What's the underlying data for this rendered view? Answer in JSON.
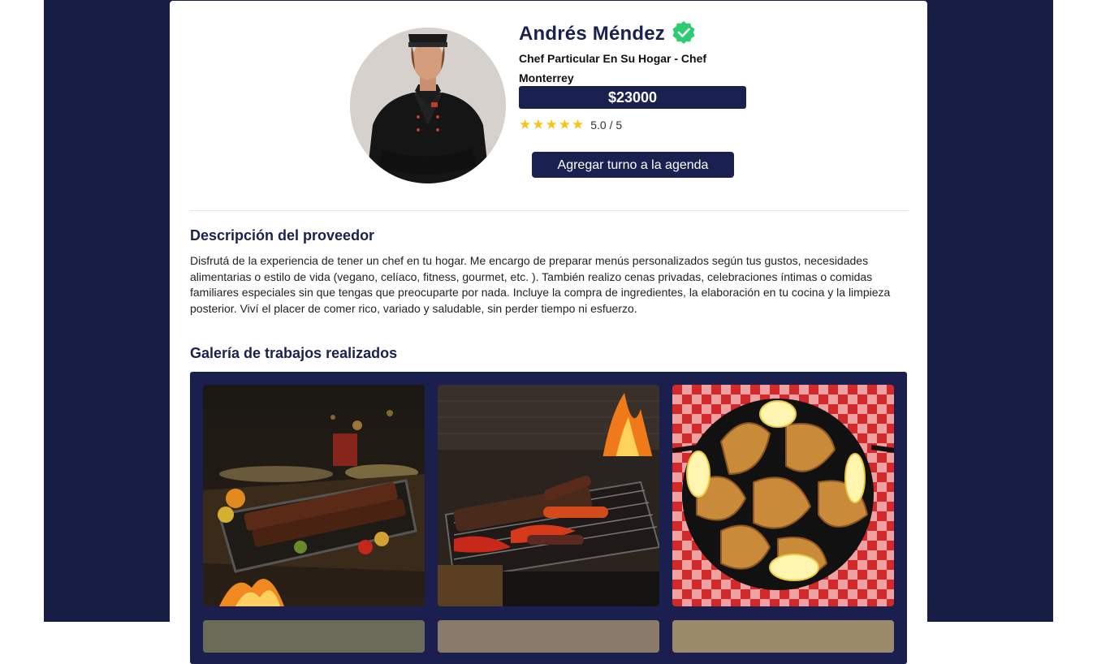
{
  "profile": {
    "name": "Andrés Méndez",
    "subtitle": "Chef Particular En Su Hogar - Chef Monterrey",
    "price": "$23000",
    "rating_text": "5.0 / 5",
    "rating_value": 5,
    "rating_max": 5,
    "verified_icon": "verified-badge-icon",
    "agenda_button": "Agregar turno a la agenda"
  },
  "description": {
    "title": "Descripción del proveedor",
    "text": "Disfrutá de la experiencia de tener un chef en tu hogar. Me encargo de preparar menús personalizados según tus gustos, necesidades alimentarias o estilo de vida (vegano, celíaco, fitness, gourmet, etc. ). También realizo cenas privadas, celebraciones íntimas o comidas familiares especiales sin que tengas que preocuparte por nada. Incluye la compra de ingredientes, la elaboración en tu cocina y la limpieza posterior. Viví el placer de comer rico, variado y saludable, sin perder tiempo ni esfuerzo."
  },
  "gallery": {
    "title": "Galería de trabajos realizados",
    "items": [
      {
        "subject": "grilled-ribs-tray-photo"
      },
      {
        "subject": "parrilla-grill-photo"
      },
      {
        "subject": "empanadas-pan-photo"
      }
    ]
  },
  "colors": {
    "navy": "#1a2150",
    "frame": "#171d45",
    "star": "#f5c518",
    "verified": "#2ecc71"
  }
}
